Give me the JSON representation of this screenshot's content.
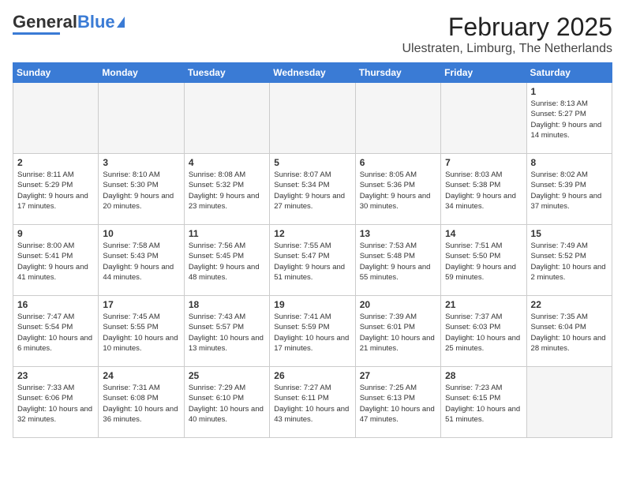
{
  "logo": {
    "general": "General",
    "blue": "Blue"
  },
  "title": {
    "month_year": "February 2025",
    "location": "Ulestraten, Limburg, The Netherlands"
  },
  "weekdays": [
    "Sunday",
    "Monday",
    "Tuesday",
    "Wednesday",
    "Thursday",
    "Friday",
    "Saturday"
  ],
  "weeks": [
    [
      {
        "day": "",
        "info": ""
      },
      {
        "day": "",
        "info": ""
      },
      {
        "day": "",
        "info": ""
      },
      {
        "day": "",
        "info": ""
      },
      {
        "day": "",
        "info": ""
      },
      {
        "day": "",
        "info": ""
      },
      {
        "day": "1",
        "info": "Sunrise: 8:13 AM\nSunset: 5:27 PM\nDaylight: 9 hours and 14 minutes."
      }
    ],
    [
      {
        "day": "2",
        "info": "Sunrise: 8:11 AM\nSunset: 5:29 PM\nDaylight: 9 hours and 17 minutes."
      },
      {
        "day": "3",
        "info": "Sunrise: 8:10 AM\nSunset: 5:30 PM\nDaylight: 9 hours and 20 minutes."
      },
      {
        "day": "4",
        "info": "Sunrise: 8:08 AM\nSunset: 5:32 PM\nDaylight: 9 hours and 23 minutes."
      },
      {
        "day": "5",
        "info": "Sunrise: 8:07 AM\nSunset: 5:34 PM\nDaylight: 9 hours and 27 minutes."
      },
      {
        "day": "6",
        "info": "Sunrise: 8:05 AM\nSunset: 5:36 PM\nDaylight: 9 hours and 30 minutes."
      },
      {
        "day": "7",
        "info": "Sunrise: 8:03 AM\nSunset: 5:38 PM\nDaylight: 9 hours and 34 minutes."
      },
      {
        "day": "8",
        "info": "Sunrise: 8:02 AM\nSunset: 5:39 PM\nDaylight: 9 hours and 37 minutes."
      }
    ],
    [
      {
        "day": "9",
        "info": "Sunrise: 8:00 AM\nSunset: 5:41 PM\nDaylight: 9 hours and 41 minutes."
      },
      {
        "day": "10",
        "info": "Sunrise: 7:58 AM\nSunset: 5:43 PM\nDaylight: 9 hours and 44 minutes."
      },
      {
        "day": "11",
        "info": "Sunrise: 7:56 AM\nSunset: 5:45 PM\nDaylight: 9 hours and 48 minutes."
      },
      {
        "day": "12",
        "info": "Sunrise: 7:55 AM\nSunset: 5:47 PM\nDaylight: 9 hours and 51 minutes."
      },
      {
        "day": "13",
        "info": "Sunrise: 7:53 AM\nSunset: 5:48 PM\nDaylight: 9 hours and 55 minutes."
      },
      {
        "day": "14",
        "info": "Sunrise: 7:51 AM\nSunset: 5:50 PM\nDaylight: 9 hours and 59 minutes."
      },
      {
        "day": "15",
        "info": "Sunrise: 7:49 AM\nSunset: 5:52 PM\nDaylight: 10 hours and 2 minutes."
      }
    ],
    [
      {
        "day": "16",
        "info": "Sunrise: 7:47 AM\nSunset: 5:54 PM\nDaylight: 10 hours and 6 minutes."
      },
      {
        "day": "17",
        "info": "Sunrise: 7:45 AM\nSunset: 5:55 PM\nDaylight: 10 hours and 10 minutes."
      },
      {
        "day": "18",
        "info": "Sunrise: 7:43 AM\nSunset: 5:57 PM\nDaylight: 10 hours and 13 minutes."
      },
      {
        "day": "19",
        "info": "Sunrise: 7:41 AM\nSunset: 5:59 PM\nDaylight: 10 hours and 17 minutes."
      },
      {
        "day": "20",
        "info": "Sunrise: 7:39 AM\nSunset: 6:01 PM\nDaylight: 10 hours and 21 minutes."
      },
      {
        "day": "21",
        "info": "Sunrise: 7:37 AM\nSunset: 6:03 PM\nDaylight: 10 hours and 25 minutes."
      },
      {
        "day": "22",
        "info": "Sunrise: 7:35 AM\nSunset: 6:04 PM\nDaylight: 10 hours and 28 minutes."
      }
    ],
    [
      {
        "day": "23",
        "info": "Sunrise: 7:33 AM\nSunset: 6:06 PM\nDaylight: 10 hours and 32 minutes."
      },
      {
        "day": "24",
        "info": "Sunrise: 7:31 AM\nSunset: 6:08 PM\nDaylight: 10 hours and 36 minutes."
      },
      {
        "day": "25",
        "info": "Sunrise: 7:29 AM\nSunset: 6:10 PM\nDaylight: 10 hours and 40 minutes."
      },
      {
        "day": "26",
        "info": "Sunrise: 7:27 AM\nSunset: 6:11 PM\nDaylight: 10 hours and 43 minutes."
      },
      {
        "day": "27",
        "info": "Sunrise: 7:25 AM\nSunset: 6:13 PM\nDaylight: 10 hours and 47 minutes."
      },
      {
        "day": "28",
        "info": "Sunrise: 7:23 AM\nSunset: 6:15 PM\nDaylight: 10 hours and 51 minutes."
      },
      {
        "day": "",
        "info": ""
      }
    ]
  ]
}
